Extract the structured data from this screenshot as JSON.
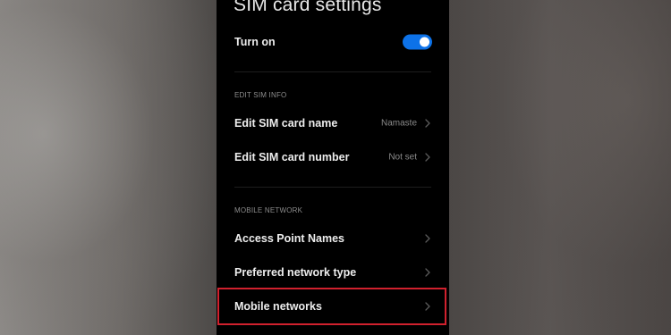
{
  "page": {
    "title": "SIM card settings"
  },
  "turn_on": {
    "label": "Turn on",
    "enabled": true,
    "accent_color": "#0d72e8"
  },
  "sections": {
    "edit_sim_info": {
      "header": "EDIT SIM INFO",
      "items": [
        {
          "label": "Edit SIM card name",
          "value": "Namaste"
        },
        {
          "label": "Edit SIM card number",
          "value": "Not set"
        }
      ]
    },
    "mobile_network": {
      "header": "MOBILE NETWORK",
      "items": [
        {
          "label": "Access Point Names"
        },
        {
          "label": "Preferred network type"
        },
        {
          "label": "Mobile networks",
          "highlighted": true
        }
      ]
    }
  },
  "icons": {
    "chevron": "chevron-right-icon",
    "toggle": "toggle-switch"
  },
  "colors": {
    "background": "#000000",
    "highlight_border": "#d1212e"
  }
}
